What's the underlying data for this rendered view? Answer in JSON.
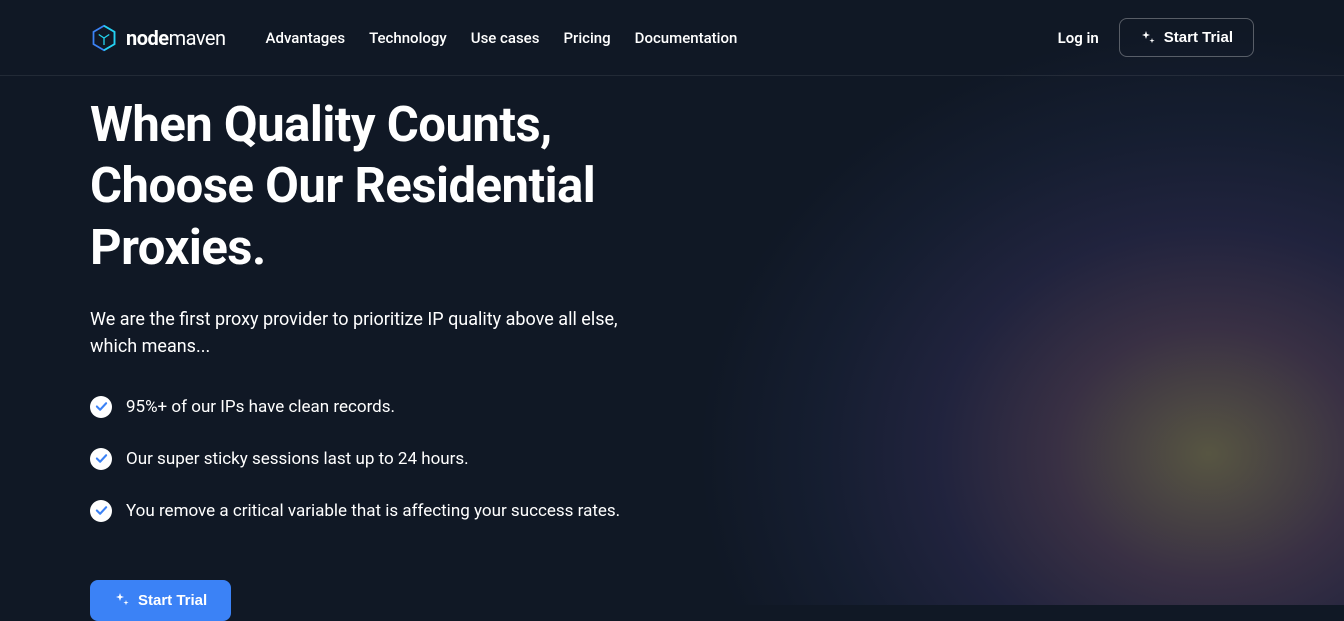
{
  "brand": {
    "name_bold": "node",
    "name_regular": "maven"
  },
  "nav": {
    "items": [
      {
        "label": "Advantages"
      },
      {
        "label": "Technology"
      },
      {
        "label": "Use cases"
      },
      {
        "label": "Pricing"
      },
      {
        "label": "Documentation"
      }
    ]
  },
  "header": {
    "login_label": "Log in",
    "trial_label": "Start Trial"
  },
  "hero": {
    "title_line1": "When Quality Counts,",
    "title_line2": "Choose Our Residential",
    "title_line3": "Proxies.",
    "subtitle": "We are the first proxy provider to prioritize IP quality above all else, which means...",
    "features": [
      {
        "text": "95%+ of our IPs have clean records."
      },
      {
        "text": "Our super sticky sessions last up to 24 hours."
      },
      {
        "text": "You remove a critical variable that is affecting your success rates."
      }
    ],
    "cta_label": "Start Trial"
  }
}
